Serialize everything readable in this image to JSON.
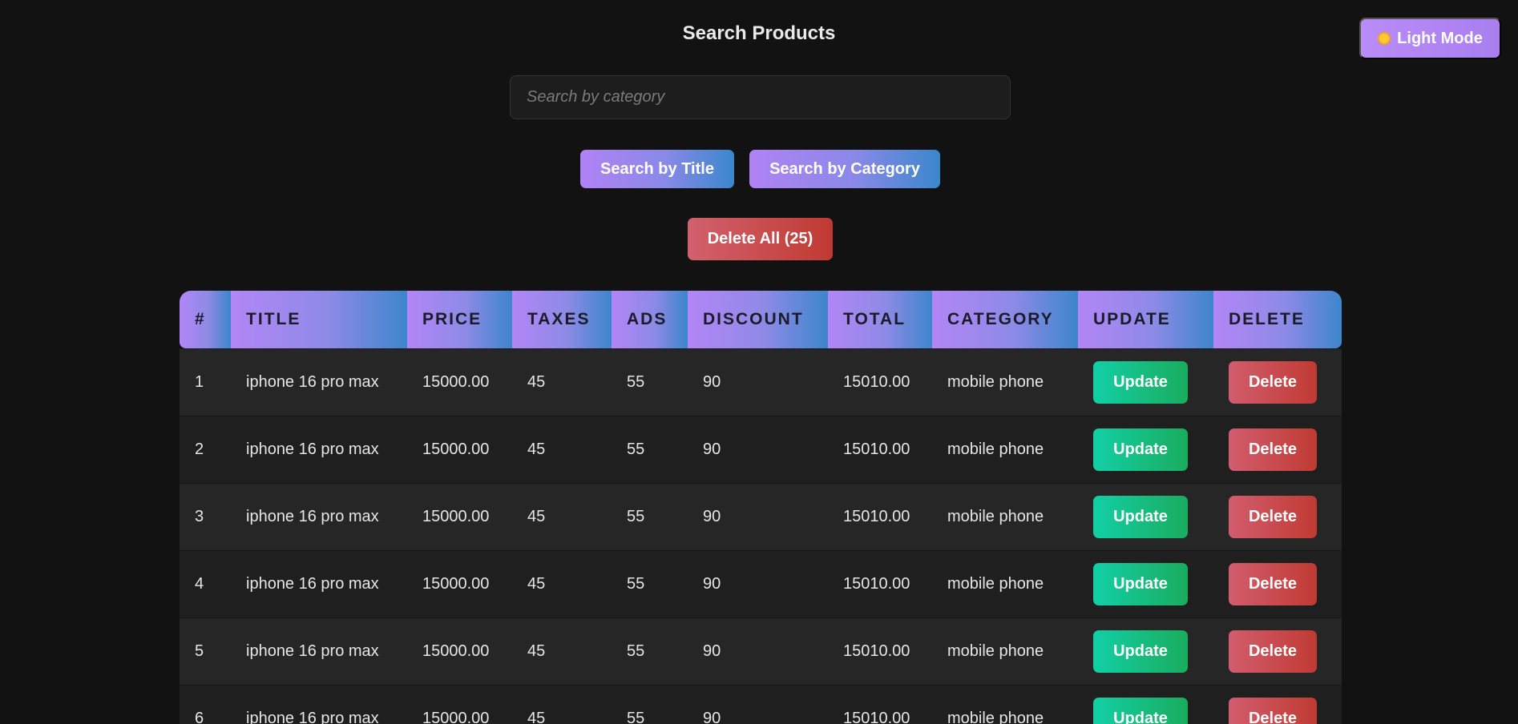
{
  "mode_toggle": {
    "label": "Light Mode",
    "icon": "sun-icon"
  },
  "search": {
    "title": "Search Products",
    "placeholder": "Search by category",
    "value": "",
    "by_title_label": "Search by Title",
    "by_category_label": "Search by Category"
  },
  "delete_all_label": "Delete All (25)",
  "table": {
    "headers": [
      "#",
      "TITLE",
      "PRICE",
      "TAXES",
      "ADS",
      "DISCOUNT",
      "TOTAL",
      "CATEGORY",
      "UPDATE",
      "DELETE"
    ],
    "update_label": "Update",
    "delete_label": "Delete",
    "rows": [
      {
        "id": "1",
        "title": "iphone 16 pro max",
        "price": "15000.00",
        "taxes": "45",
        "ads": "55",
        "discount": "90",
        "total": "15010.00",
        "category": "mobile phone"
      },
      {
        "id": "2",
        "title": "iphone 16 pro max",
        "price": "15000.00",
        "taxes": "45",
        "ads": "55",
        "discount": "90",
        "total": "15010.00",
        "category": "mobile phone"
      },
      {
        "id": "3",
        "title": "iphone 16 pro max",
        "price": "15000.00",
        "taxes": "45",
        "ads": "55",
        "discount": "90",
        "total": "15010.00",
        "category": "mobile phone"
      },
      {
        "id": "4",
        "title": "iphone 16 pro max",
        "price": "15000.00",
        "taxes": "45",
        "ads": "55",
        "discount": "90",
        "total": "15010.00",
        "category": "mobile phone"
      },
      {
        "id": "5",
        "title": "iphone 16 pro max",
        "price": "15000.00",
        "taxes": "45",
        "ads": "55",
        "discount": "90",
        "total": "15010.00",
        "category": "mobile phone"
      },
      {
        "id": "6",
        "title": "iphone 16 pro max",
        "price": "15000.00",
        "taxes": "45",
        "ads": "55",
        "discount": "90",
        "total": "15010.00",
        "category": "mobile phone"
      }
    ]
  },
  "colors": {
    "background": "#121212",
    "accent_purple": "#b182f4",
    "accent_blue": "#3a87cc",
    "update_green": "#12cfa6",
    "delete_red": "#c03a32"
  }
}
